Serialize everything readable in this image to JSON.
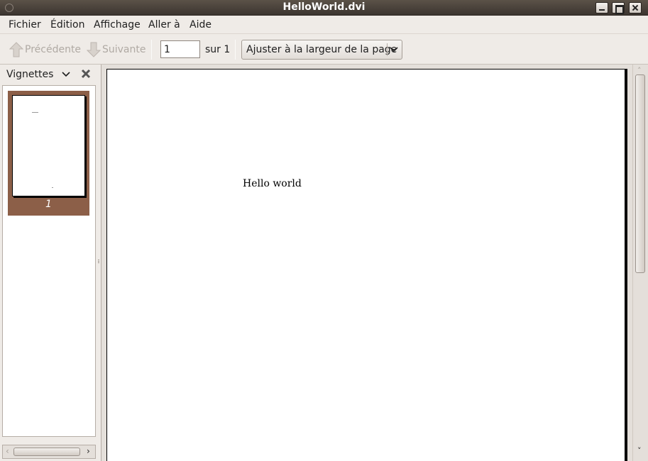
{
  "window": {
    "title": "HelloWorld.dvi"
  },
  "menubar": {
    "items": [
      {
        "label": "Fichier"
      },
      {
        "label": "Édition"
      },
      {
        "label": "Affichage"
      },
      {
        "label": "Aller à"
      },
      {
        "label": "Aide"
      }
    ]
  },
  "toolbar": {
    "previous_label": "Précédente",
    "next_label": "Suivante",
    "page_value": "1",
    "page_total": "sur 1",
    "zoom_value": "Ajuster à la largeur de la page"
  },
  "sidebar": {
    "title": "Vignettes",
    "thumbnails": [
      {
        "label": "1"
      }
    ]
  },
  "document": {
    "text": "Hello world"
  },
  "colors": {
    "titlebar": "#3c3530",
    "selection": "#8c5f48",
    "window_bg": "#efebe7"
  },
  "icons": {
    "previous": "arrow-up-icon",
    "next": "arrow-down-icon",
    "sidebar_close": "close-icon",
    "sidebar_menu": "chevron-down-icon"
  }
}
